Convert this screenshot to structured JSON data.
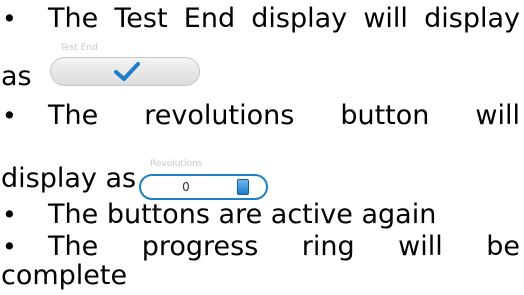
{
  "bullet_symbol": "•",
  "items": [
    {
      "line1_words": [
        "The",
        "Test",
        "End",
        "display",
        "will",
        "display"
      ],
      "line2_prefix": "as"
    },
    {
      "line1_words": [
        "The",
        "revolutions",
        "button",
        "will"
      ],
      "line2_prefix": "display as"
    },
    {
      "line1_words": [
        "The",
        "buttons",
        "are",
        "active",
        "again"
      ]
    },
    {
      "line1_words": [
        "The",
        "progress",
        "ring",
        "will",
        "be"
      ],
      "line2": "complete"
    }
  ],
  "revolutions_button": {
    "value": "0",
    "faint_label": "Revolutions"
  },
  "test_end_display": {
    "icon": "checkmark-icon",
    "faint_label": "Test End"
  },
  "colors": {
    "checkmark": "#1e7ecb",
    "revolutions_border": "#1d7fc4",
    "pill_gray": "#dcdcdc"
  }
}
